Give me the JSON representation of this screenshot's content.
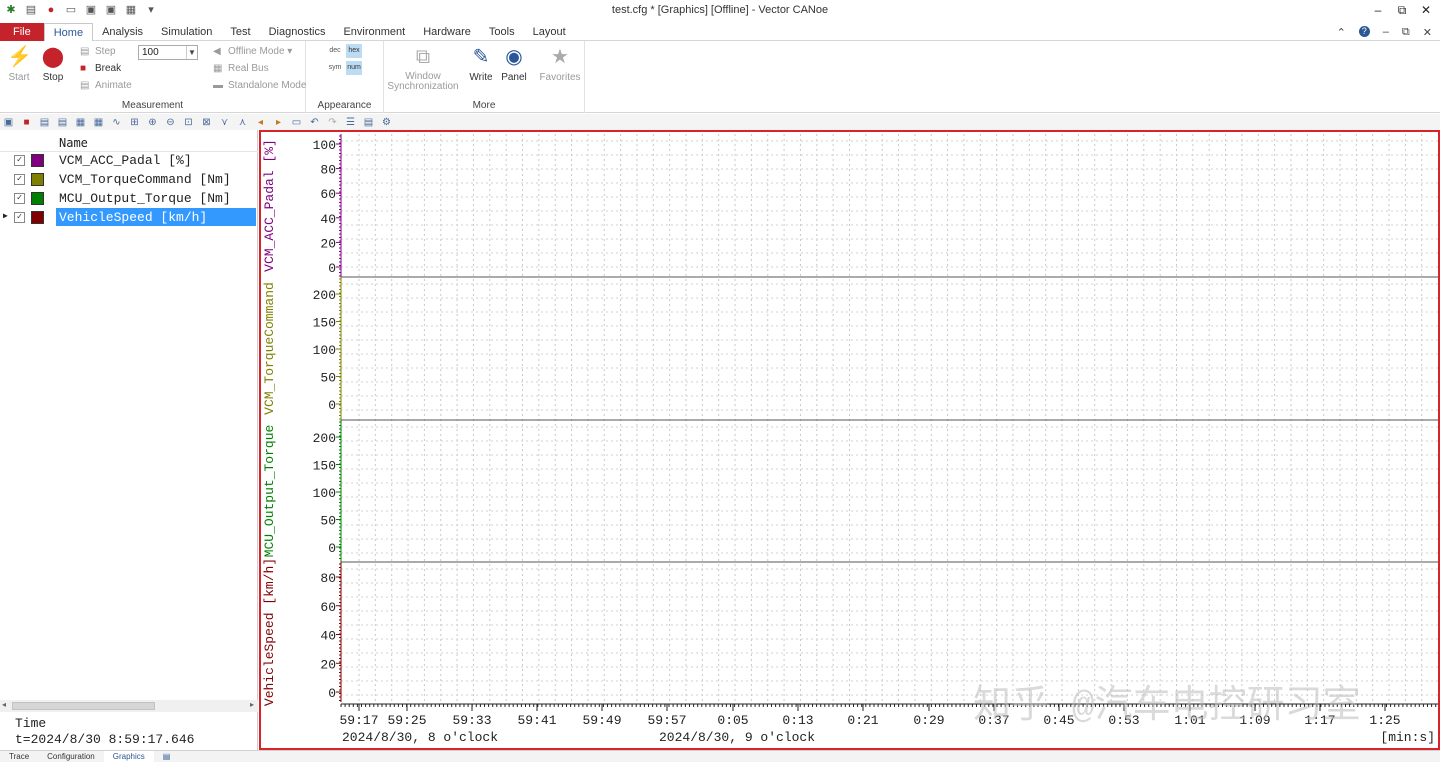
{
  "window": {
    "title": "test.cfg * [Graphics] [Offline] - Vector CANoe",
    "minimize": "–",
    "restore": "⧉",
    "close": "✕"
  },
  "menu": {
    "file": "File",
    "items": [
      "Home",
      "Analysis",
      "Simulation",
      "Test",
      "Diagnostics",
      "Environment",
      "Hardware",
      "Tools",
      "Layout"
    ],
    "right": [
      "⌃",
      "?",
      "–",
      "⧉",
      "✕"
    ]
  },
  "ribbon": {
    "measurement": {
      "label": "Measurement",
      "start": "Start",
      "stop": "Stop",
      "step": "Step",
      "break": "Break",
      "animate": "Animate",
      "speed_value": "100",
      "offline_mode": "Offline Mode",
      "real_bus": "Real Bus",
      "standalone_mode": "Standalone Mode"
    },
    "appearance": {
      "label": "Appearance",
      "dec": "dec",
      "hex": "hex",
      "sym": "sym",
      "num": "num"
    },
    "more": {
      "label": "More",
      "window_sync_1": "Window",
      "window_sync_2": "Synchronization",
      "write": "Write",
      "panel": "Panel",
      "favorites": "Favorites"
    }
  },
  "signal_list": {
    "header": "Name",
    "signals": [
      {
        "name": "VCM_ACC_Padal [%]",
        "color": "#800080",
        "checked": true,
        "selected": false
      },
      {
        "name": "VCM_TorqueCommand [Nm]",
        "color": "#808000",
        "checked": true,
        "selected": false
      },
      {
        "name": "MCU_Output_Torque [Nm]",
        "color": "#008000",
        "checked": true,
        "selected": false
      },
      {
        "name": "VehicleSpeed [km/h]",
        "color": "#800000",
        "checked": true,
        "selected": true
      }
    ],
    "time_label": "Time",
    "time_value": "t=2024/8/30 8:59:17.646"
  },
  "bottom_tabs": [
    "Trace",
    "Configuration",
    "Graphics"
  ],
  "chart_data": {
    "type": "line",
    "panels": [
      {
        "axis_label": "VCM_ACC_Padal [%]",
        "color": "#800080",
        "ticks": [
          "100",
          "80",
          "60",
          "40",
          "20",
          "0"
        ],
        "ylim": [
          0,
          100
        ]
      },
      {
        "axis_label": "VCM_TorqueCommand",
        "color": "#808000",
        "ticks": [
          "200",
          "150",
          "100",
          "50",
          "0"
        ],
        "ylim": [
          0,
          200
        ]
      },
      {
        "axis_label": "MCU_Output_Torque",
        "color": "#008000",
        "ticks": [
          "200",
          "150",
          "100",
          "50",
          "0"
        ],
        "ylim": [
          0,
          200
        ]
      },
      {
        "axis_label": "VehicleSpeed [km/h]",
        "color": "#800000",
        "ticks": [
          "80",
          "60",
          "40",
          "20",
          "0"
        ],
        "ylim": [
          0,
          80
        ]
      }
    ],
    "x_ticks": [
      "59:17",
      "59:25",
      "59:33",
      "59:41",
      "59:49",
      "59:57",
      "0:05",
      "0:13",
      "0:21",
      "0:29",
      "0:37",
      "0:45",
      "0:53",
      "1:01",
      "1:09",
      "1:17",
      "1:25"
    ],
    "x_dates": [
      "2024/8/30, 8 o'clock",
      "2024/8/30, 9 o'clock"
    ],
    "x_unit": "[min:s]",
    "grid": true,
    "series": []
  },
  "watermark": "知乎 @汽车电控研习室"
}
